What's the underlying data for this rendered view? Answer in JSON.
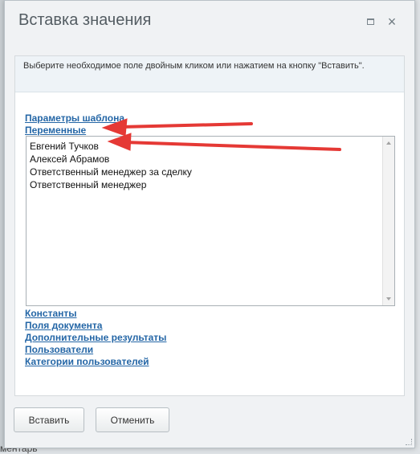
{
  "background": {
    "bottom_text": "ментарь"
  },
  "dialog": {
    "title": "Вставка значения",
    "hint": "Выберите необходимое поле двойным кликом или нажатием на кнопку \"Вставить\".",
    "sections_top": [
      "Параметры шаблона",
      "Переменные"
    ],
    "list_items": [
      "Евгений Тучков",
      "Алексей Абрамов",
      "Ответственный менеджер за сделку",
      "Ответственный менеджер"
    ],
    "sections_bottom": [
      "Константы",
      "Поля документа",
      "Дополнительные результаты",
      "Пользователи",
      "Категории пользователей"
    ],
    "buttons": {
      "insert": "Вставить",
      "cancel": "Отменить"
    },
    "close_glyph": "×",
    "colors": {
      "link": "#2466a6",
      "annotation_arrow": "#e53935"
    }
  }
}
